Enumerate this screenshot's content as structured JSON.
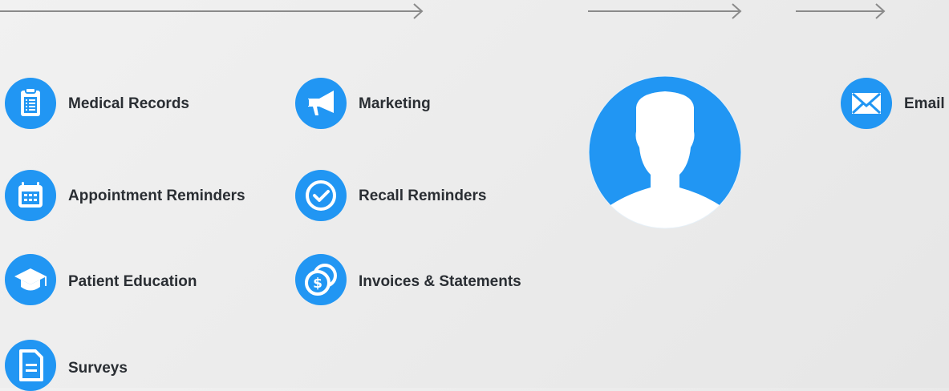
{
  "colors": {
    "accent": "#2196F3",
    "text": "#2a2e33",
    "arrow": "#8a8a8a"
  },
  "items": {
    "medical_records": {
      "label": "Medical Records",
      "icon": "clipboard-icon"
    },
    "appointment_reminders": {
      "label": "Appointment Reminders",
      "icon": "calendar-icon"
    },
    "patient_education": {
      "label": "Patient Education",
      "icon": "graduation-cap-icon"
    },
    "surveys": {
      "label": "Surveys",
      "icon": "document-icon"
    },
    "marketing": {
      "label": "Marketing",
      "icon": "megaphone-icon"
    },
    "recall_reminders": {
      "label": "Recall Reminders",
      "icon": "checkmark-icon"
    },
    "invoices": {
      "label": "Invoices & Statements",
      "icon": "coins-icon"
    },
    "email": {
      "label": "Email",
      "icon": "envelope-icon"
    }
  },
  "avatar": {
    "icon": "user-silhouette-icon"
  }
}
